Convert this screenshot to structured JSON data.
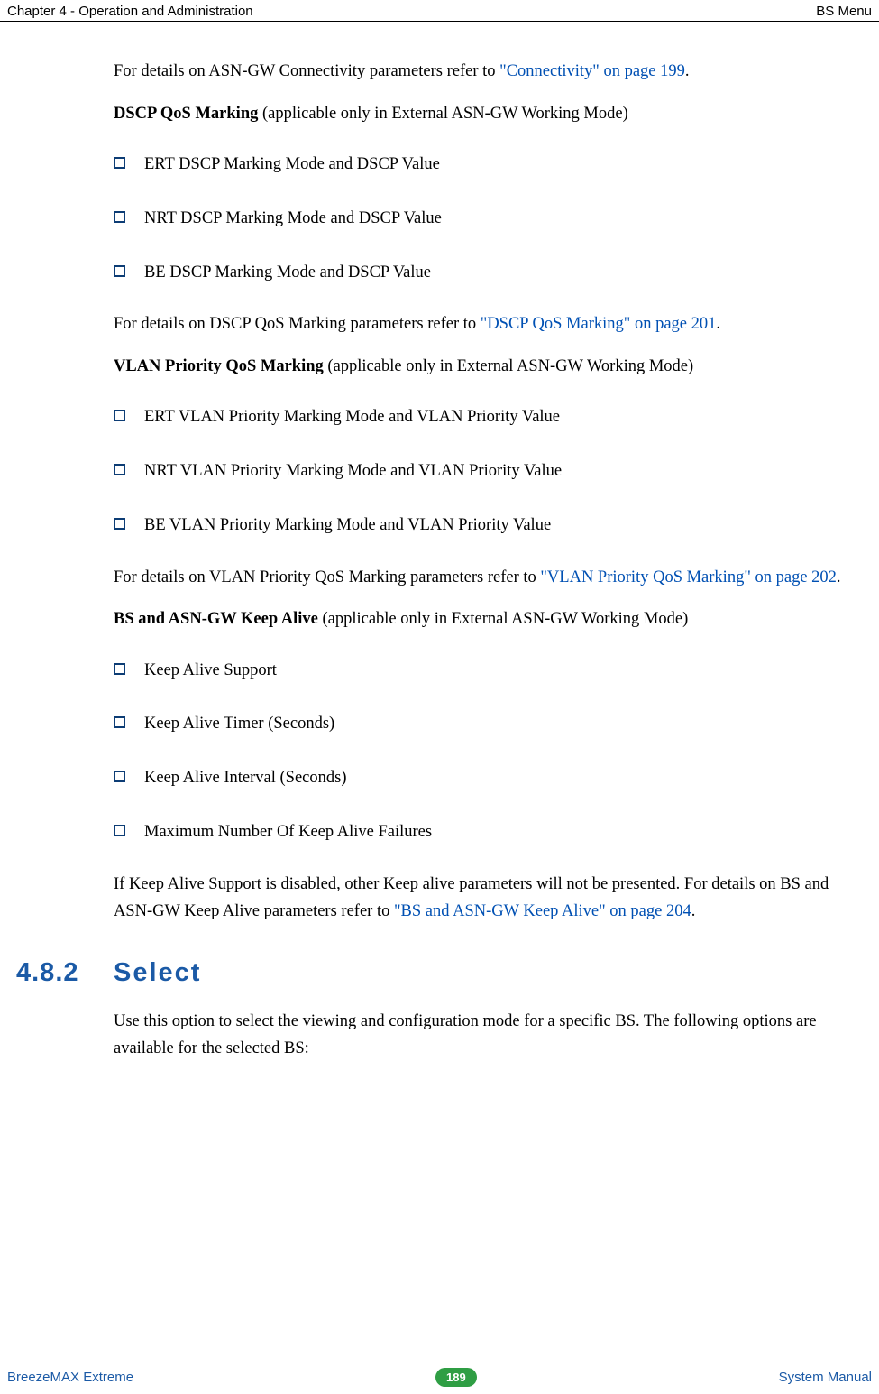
{
  "header": {
    "left": "Chapter 4 - Operation and Administration",
    "right": "BS Menu"
  },
  "body": {
    "p1_pre": "For details on ASN-GW Connectivity parameters refer to ",
    "p1_link": "\"Connectivity\" on page 199",
    "p1_post": ".",
    "dscp_heading_bold": "DSCP QoS Marking",
    "dscp_heading_rest": " (applicable only in External ASN-GW Working Mode)",
    "dscp_items": [
      "ERT DSCP Marking Mode and DSCP Value",
      "NRT DSCP Marking Mode and DSCP Value",
      "BE DSCP Marking Mode and DSCP Value"
    ],
    "p2_pre": "For details on DSCP QoS Marking parameters refer to ",
    "p2_link": "\"DSCP QoS Marking\" on page 201",
    "p2_post": ".",
    "vlan_heading_bold": "VLAN Priority QoS Marking",
    "vlan_heading_rest": " (applicable only in External ASN-GW Working Mode)",
    "vlan_items": [
      "ERT VLAN Priority Marking Mode and VLAN Priority Value",
      "NRT VLAN Priority Marking Mode and VLAN Priority Value",
      "BE VLAN Priority Marking Mode and VLAN Priority Value"
    ],
    "p3_pre": "For details on VLAN Priority QoS Marking parameters refer to ",
    "p3_link": "\"VLAN Priority QoS Marking\" on page 202",
    "p3_post": ".",
    "keep_heading_bold": "BS and ASN-GW Keep Alive",
    "keep_heading_rest": " (applicable only in External ASN-GW Working Mode)",
    "keep_items": [
      "Keep Alive Support",
      "Keep Alive Timer (Seconds)",
      "Keep Alive Interval (Seconds)",
      "Maximum Number Of Keep Alive Failures"
    ],
    "p4_pre": "If Keep Alive Support is disabled, other Keep alive parameters will not be presented. For details on BS and ASN-GW Keep Alive parameters refer to ",
    "p4_link": "\"BS and ASN-GW Keep Alive\" on page 204",
    "p4_post": ".",
    "h2_num": "4.8.2",
    "h2_title": "Select",
    "p5": "Use this option to select the viewing and configuration mode for a specific BS. The following options are available for the selected BS:"
  },
  "footer": {
    "left": "BreezeMAX Extreme",
    "page": "189",
    "right": "System Manual"
  }
}
